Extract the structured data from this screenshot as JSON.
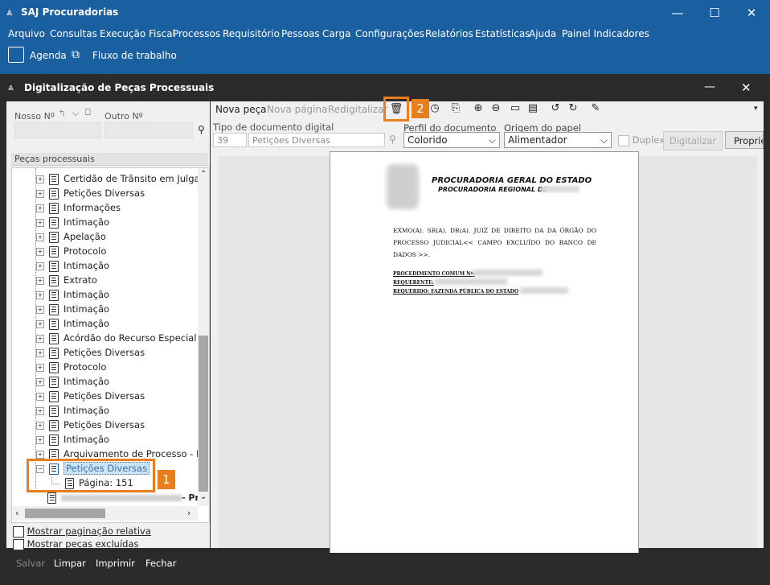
{
  "window": {
    "title": "SAJ Procuradorias"
  },
  "menu": [
    "Arquivo",
    "Consultas",
    "Execução Fiscal",
    "Processos",
    "Requisitório",
    "Pessoas",
    "Carga",
    "Configurações",
    "Relatórios",
    "Estatísticas",
    "Ajuda",
    "Painel Indicadores"
  ],
  "toolbar": {
    "agenda": "Agenda",
    "workflow": "Fluxo de trabalho"
  },
  "dialog": {
    "title": "Digitalização de Peças Processuais"
  },
  "left": {
    "nosso_label": "Nosso Nº",
    "outro_label": "Outro Nº",
    "section_title": "Peças processuais",
    "items": [
      "Certidão de Trânsito em Julgado",
      "Petições Diversas",
      "Informações",
      "Intimação",
      "Apelação",
      "Protocolo",
      "Intimação",
      "Extrato",
      "Intimação",
      "Intimação",
      "Intimação",
      "Acórdão do Recurso Especial",
      "Petições Diversas",
      "Protocolo",
      "Intimação",
      "Petições Diversas",
      "Intimação",
      "Petições Diversas",
      "Intimação",
      "Arquivamento de Processo - Defe"
    ],
    "selected_item": "Petições Diversas",
    "page_item": "Página: 151",
    "bottom_item_suffix": "- Pro",
    "chk_relative": "Mostrar paginação relativa",
    "chk_deleted": "Mostrar peças excluídas"
  },
  "right": {
    "nova_peca": "Nova peça",
    "nova_pagina": "Nova página",
    "redigitalizar": "Redigitalizar",
    "tipo_label": "Tipo de documento digital",
    "tipo_code": "39",
    "tipo_value": "Petições Diversas",
    "perfil_label": "Perfil do documento",
    "perfil_value": "Colorido",
    "origem_label": "Origem do papel",
    "origem_value": "Alimentador",
    "duplex": "Duplex",
    "digitalizar": "Digitalizar",
    "proprie": "Proprie"
  },
  "doc": {
    "h1": "PROCURADORIA GERAL DO ESTADO",
    "h2": "PROCURADORIA REGIONAL DE",
    "body": "EXMO(A). SR(A). DR(A). JUIZ DE DIREITO DA  DA ÓRGÃO DO PROCESSO JUDICIAL<< CAMPO EXCLUÍDO DO BANCO DE DADOS >>.",
    "l1": "PROCEDIMENTO COMUM Nº:",
    "l2": "REQUERENTE:",
    "l3": "REQUERIDO: FAZENDA PÚBLICA DO ESTADO"
  },
  "bottom": {
    "salvar": "Salvar",
    "limpar": "Limpar",
    "imprimir": "Imprimir",
    "fechar": "Fechar"
  },
  "annotations": {
    "one": "1",
    "two": "2"
  },
  "colors": {
    "titlebar": "#1a5fa0",
    "dark": "#2b2b2b",
    "accent": "#e87e1e",
    "selection": "#cce4f7"
  }
}
